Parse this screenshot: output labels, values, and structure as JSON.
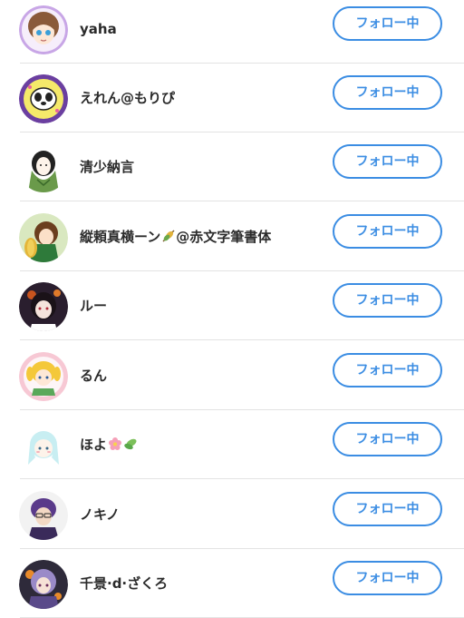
{
  "follow_button_label": "フォロー中",
  "colors": {
    "accent": "#3b8de3",
    "divider": "#e3e3e3",
    "text": "#2b2b2b"
  },
  "users": [
    {
      "name": "yaha"
    },
    {
      "name": "えれん@もりぴ"
    },
    {
      "name": "清少納言"
    },
    {
      "name": "縦頼真横ーン",
      "name_suffix": "@赤文字筆書体",
      "emoji_icon": "leaf-fan-emoji"
    },
    {
      "name": "ルー"
    },
    {
      "name": "るん"
    },
    {
      "name": "ほよ",
      "emoji_icons": [
        "cherry-blossom-emoji",
        "leaf-emoji"
      ]
    },
    {
      "name": "ノキノ"
    },
    {
      "name": "千景·d·ざくろ"
    }
  ]
}
